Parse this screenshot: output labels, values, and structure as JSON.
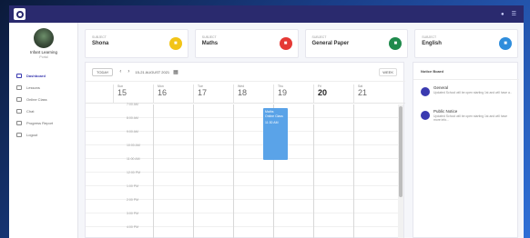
{
  "topbar": {
    "icons": [
      "notification-icon",
      "user-menu-icon"
    ]
  },
  "brand": {
    "name": "Infant Learning",
    "sub": "Portal"
  },
  "nav": {
    "items": [
      {
        "label": "Dashboard",
        "icon": "dashboard-icon"
      },
      {
        "label": "Lessons",
        "icon": "lessons-icon"
      },
      {
        "label": "Online Class",
        "icon": "online-class-icon"
      },
      {
        "label": "Chat",
        "icon": "chat-icon"
      },
      {
        "label": "Progress Report",
        "icon": "report-icon"
      },
      {
        "label": "Logout",
        "icon": "logout-icon"
      }
    ]
  },
  "cards": [
    {
      "sub": "SUBJECT",
      "name": "Shona",
      "color": "#f2c417"
    },
    {
      "sub": "SUBJECT",
      "name": "Maths",
      "color": "#e53935"
    },
    {
      "sub": "SUBJECT",
      "name": "General Paper",
      "color": "#1f8a4c"
    },
    {
      "sub": "SUBJECT",
      "name": "English",
      "color": "#2f8ddc"
    }
  ],
  "calendar": {
    "today_label": "TODAY",
    "date_range": "15-21 AUGUST 2021",
    "view_label": "WEEK",
    "days": [
      {
        "name": "Sun",
        "date": "15"
      },
      {
        "name": "Mon",
        "date": "16"
      },
      {
        "name": "Tue",
        "date": "17"
      },
      {
        "name": "Wed",
        "date": "18"
      },
      {
        "name": "Thu",
        "date": "19"
      },
      {
        "name": "Fri",
        "date": "20"
      },
      {
        "name": "Sat",
        "date": "21"
      }
    ],
    "times": [
      "7:00 AM",
      "8:00 AM",
      "9:00 AM",
      "10:00 AM",
      "11:00 AM",
      "12:00 PM",
      "1:00 PM",
      "2:00 PM",
      "3:00 PM",
      "4:00 PM"
    ],
    "event": {
      "title": "Maths",
      "subtitle": "Online Class",
      "time": "11:30 AM"
    }
  },
  "notice_board": {
    "title": "Notice Board",
    "items": [
      {
        "title": "General",
        "body": "Updated School will be open starting 1st and will have a.."
      },
      {
        "title": "Public Notice",
        "body": "Updated School will be open starting 1st and will have more info..."
      }
    ]
  }
}
